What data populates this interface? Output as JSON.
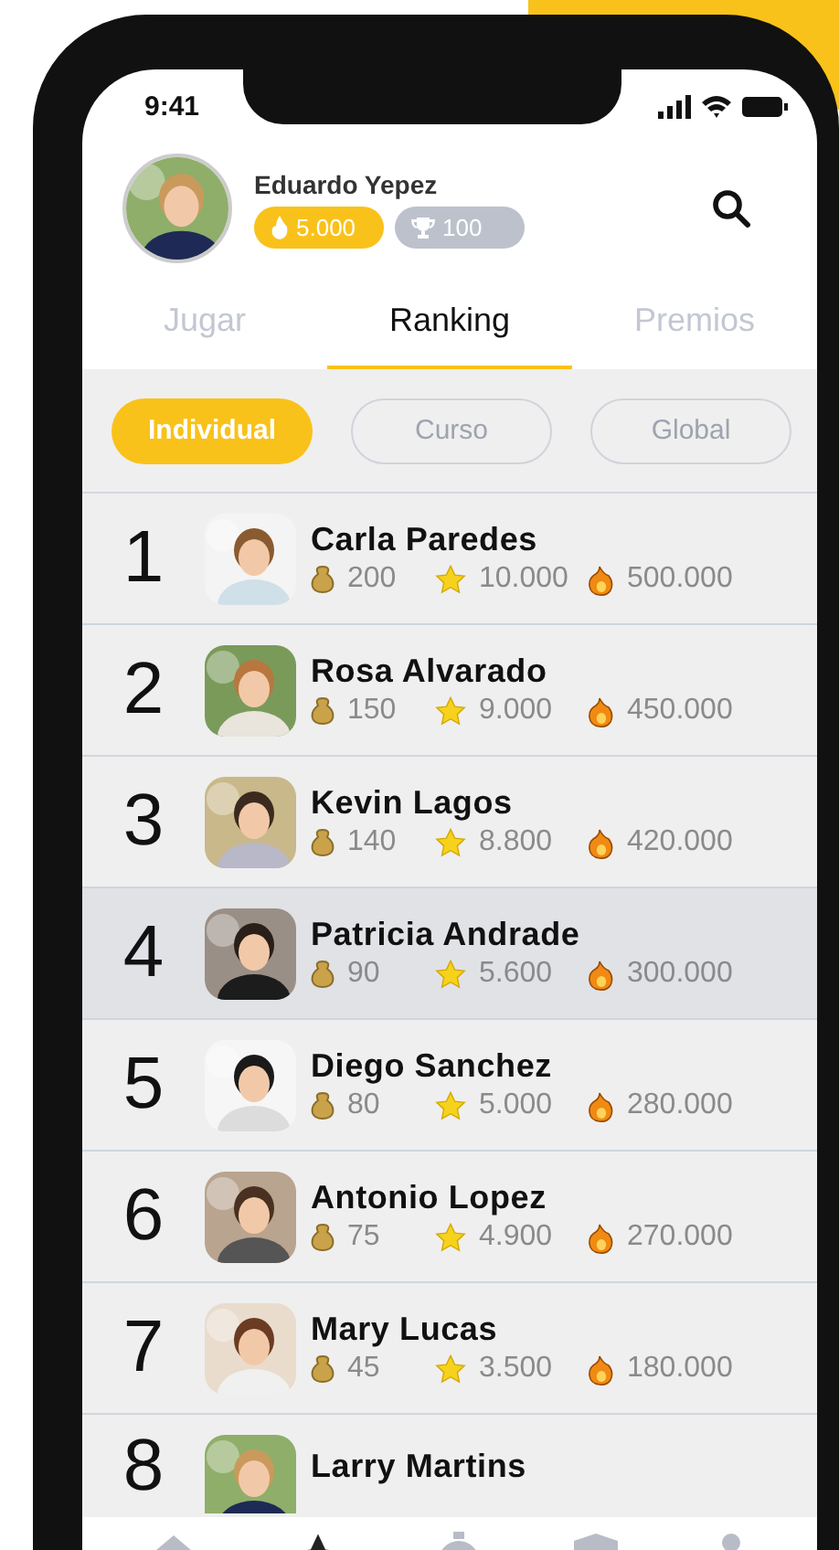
{
  "status_bar": {
    "time": "9:41"
  },
  "profile": {
    "name": "Eduardo Yepez",
    "badges": [
      {
        "kind": "fire",
        "value": "5.000"
      },
      {
        "kind": "trophy",
        "value": "100"
      }
    ]
  },
  "tabs": [
    {
      "label": "Jugar",
      "selected": false
    },
    {
      "label": "Ranking",
      "selected": true
    },
    {
      "label": "Premios",
      "selected": false
    }
  ],
  "filters": [
    {
      "label": "Individual",
      "selected": true
    },
    {
      "label": "Curso",
      "selected": false
    },
    {
      "label": "Global",
      "selected": false
    }
  ],
  "ranking": [
    {
      "rank": "1",
      "name": "Carla Paredes",
      "selected": false,
      "stats": [
        {
          "kind": "bag",
          "value": "200"
        },
        {
          "kind": "star",
          "value": "10.000"
        },
        {
          "kind": "fire",
          "value": "500.000"
        }
      ]
    },
    {
      "rank": "2",
      "name": "Rosa Alvarado",
      "selected": false,
      "stats": [
        {
          "kind": "bag",
          "value": "150"
        },
        {
          "kind": "star",
          "value": "9.000"
        },
        {
          "kind": "fire",
          "value": "450.000"
        }
      ]
    },
    {
      "rank": "3",
      "name": "Kevin Lagos",
      "selected": false,
      "stats": [
        {
          "kind": "bag",
          "value": "140"
        },
        {
          "kind": "star",
          "value": "8.800"
        },
        {
          "kind": "fire",
          "value": "420.000"
        }
      ]
    },
    {
      "rank": "4",
      "name": "Patricia Andrade",
      "selected": true,
      "stats": [
        {
          "kind": "bag",
          "value": "90"
        },
        {
          "kind": "star",
          "value": "5.600"
        },
        {
          "kind": "fire",
          "value": "300.000"
        }
      ]
    },
    {
      "rank": "5",
      "name": "Diego Sanchez",
      "selected": false,
      "stats": [
        {
          "kind": "bag",
          "value": "80"
        },
        {
          "kind": "star",
          "value": "5.000"
        },
        {
          "kind": "fire",
          "value": "280.000"
        }
      ]
    },
    {
      "rank": "6",
      "name": "Antonio Lopez",
      "selected": false,
      "stats": [
        {
          "kind": "bag",
          "value": "75"
        },
        {
          "kind": "star",
          "value": "4.900"
        },
        {
          "kind": "fire",
          "value": "270.000"
        }
      ]
    },
    {
      "rank": "7",
      "name": "Mary Lucas",
      "selected": false,
      "stats": [
        {
          "kind": "bag",
          "value": "45"
        },
        {
          "kind": "star",
          "value": "3.500"
        },
        {
          "kind": "fire",
          "value": "180.000"
        }
      ]
    },
    {
      "rank": "8",
      "name": "Larry Martins",
      "selected": false
    }
  ],
  "nav": [
    {
      "kind": "home",
      "selected": false
    },
    {
      "kind": "star",
      "selected": true
    },
    {
      "kind": "timer",
      "selected": false
    },
    {
      "kind": "shield",
      "selected": false
    },
    {
      "kind": "person",
      "selected": false
    }
  ]
}
